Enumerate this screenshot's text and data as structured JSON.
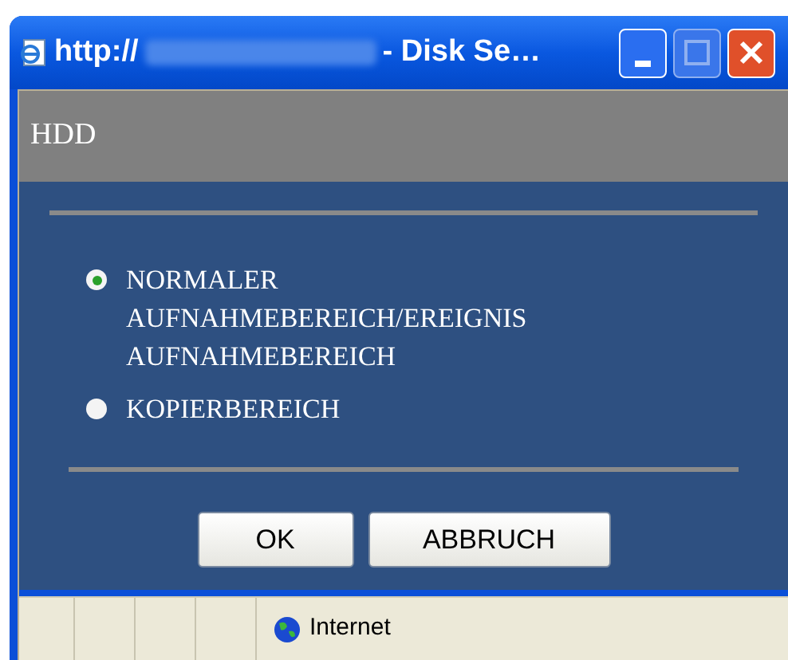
{
  "window": {
    "title_prefix": "http://",
    "title_suffix": "- Disk Se…"
  },
  "header": {
    "title": "HDD"
  },
  "options": [
    {
      "label": "NORMALER AUFNAHMEBEREICH/EREIGNIS AUFNAHMEBEREICH",
      "selected": true
    },
    {
      "label": "KOPIERBEREICH",
      "selected": false
    }
  ],
  "buttons": [
    "OK",
    "ABBRUCH"
  ],
  "status_bar": {
    "zone": "Internet"
  }
}
